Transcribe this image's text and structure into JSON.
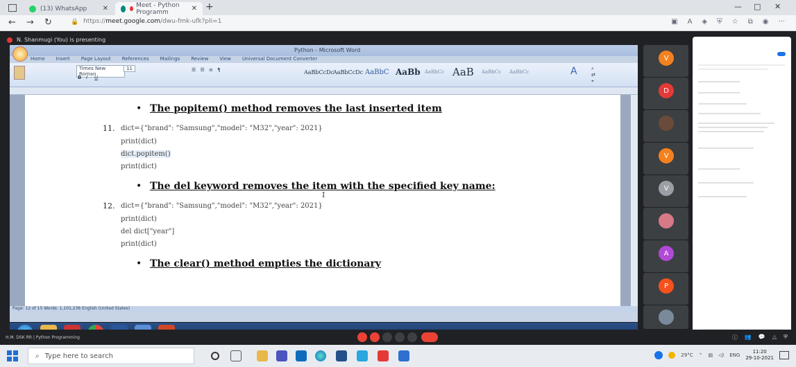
{
  "browser": {
    "tabs": [
      {
        "label": "(13) WhatsApp",
        "active": false
      },
      {
        "label": "Meet - Python Programm",
        "active": true
      }
    ],
    "address": {
      "prefix": "https://",
      "host": "meet.google.com",
      "path": "/dwu-fmk-ufk?pli=1"
    }
  },
  "meet": {
    "presenting_label": "N. Shanmugi (You) is presenting",
    "meeting_name": "H.M. DSK RR | Python Programming"
  },
  "word": {
    "window_title": "Python - Microsoft Word",
    "ribbon_tabs": [
      "Home",
      "Insert",
      "Page Layout",
      "References",
      "Mailings",
      "Review",
      "View",
      "Universal Document Converter"
    ],
    "font_name": "Times New Roman",
    "font_size": "11",
    "styles": [
      "AaBbCcDc",
      "AaBbCcDc",
      "AaBbC",
      "AaBb",
      "AaBbCc",
      "AaB",
      "AaBbCc",
      "AaBbCc"
    ],
    "status": "Page: 12 of 15   Words: 1,101,236   English (United States)"
  },
  "doc": {
    "sections": [
      {
        "heading": "The popitem() method removes the last inserted item",
        "number": "11.",
        "code": [
          "dict={\"brand\": \"Samsung\",\"model\": \"M32\",\"year\": 2021}",
          "print(dict)",
          "dict.popitem()",
          "print(dict)"
        ]
      },
      {
        "heading": "The del keyword removes the item with the specified key name:",
        "number": "12.",
        "code": [
          "dict={\"brand\": \"Samsung\",\"model\": \"M32\",\"year\": 2021}",
          "print(dict)",
          "del dict[\"year\"]",
          "print(dict)"
        ]
      },
      {
        "heading": "The clear() method empties the dictionary",
        "number": "",
        "code": []
      }
    ]
  },
  "participants": [
    {
      "initial": "V",
      "color": "#f4811f"
    },
    {
      "initial": "D",
      "color": "#e53935"
    },
    {
      "initial": "",
      "color": "#6a4a3a"
    },
    {
      "initial": "V",
      "color": "#f4811f"
    },
    {
      "initial": "V",
      "color": "#9aa0a6"
    },
    {
      "initial": "",
      "color": "#d77a88"
    },
    {
      "initial": "A",
      "color": "#b04ad6"
    },
    {
      "initial": "P",
      "color": "#f4511e"
    },
    {
      "initial": "",
      "color": "#7a8a9a"
    }
  ],
  "taskbar": {
    "search_placeholder": "Type here to search",
    "weather": "29°C",
    "lang": "ENG",
    "time": "11:20",
    "date": "29-10-2021"
  }
}
